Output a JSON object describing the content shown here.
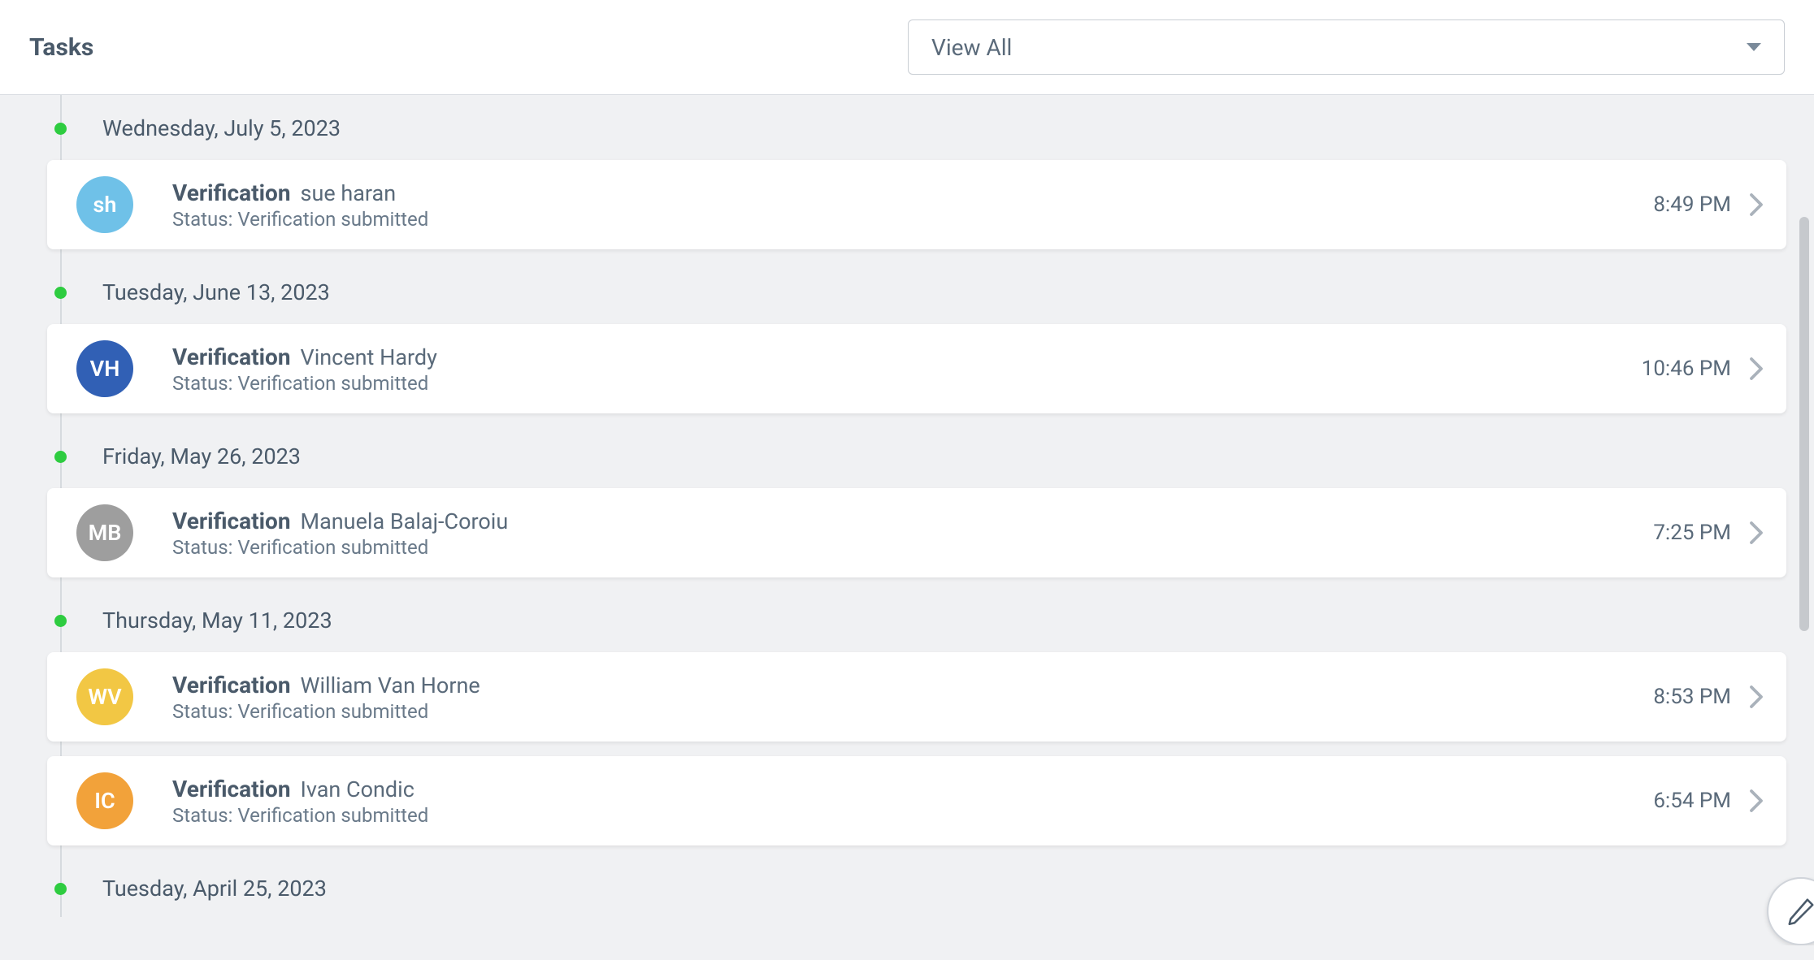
{
  "header": {
    "title": "Tasks",
    "filter_label": "View All"
  },
  "groups": [
    {
      "date": "Wednesday, July 5, 2023",
      "items": [
        {
          "type": "Verification",
          "person": "sue haran",
          "status": "Status: Verification submitted",
          "time": "8:49 PM",
          "initials": "sh",
          "avatar_color": "#6fc1e8"
        }
      ]
    },
    {
      "date": "Tuesday, June 13, 2023",
      "items": [
        {
          "type": "Verification",
          "person": "Vincent Hardy",
          "status": "Status: Verification submitted",
          "time": "10:46 PM",
          "initials": "VH",
          "avatar_color": "#3160b5"
        }
      ]
    },
    {
      "date": "Friday, May 26, 2023",
      "items": [
        {
          "type": "Verification",
          "person": "Manuela Balaj-Coroiu",
          "status": "Status: Verification submitted",
          "time": "7:25 PM",
          "initials": "MB",
          "avatar_color": "#9e9e9e"
        }
      ]
    },
    {
      "date": "Thursday, May 11, 2023",
      "items": [
        {
          "type": "Verification",
          "person": "William Van Horne",
          "status": "Status: Verification submitted",
          "time": "8:53 PM",
          "initials": "WV",
          "avatar_color": "#f2c744"
        },
        {
          "type": "Verification",
          "person": "Ivan Condic",
          "status": "Status: Verification submitted",
          "time": "6:54 PM",
          "initials": "IC",
          "avatar_color": "#f2a23a"
        }
      ]
    },
    {
      "date": "Tuesday, April 25, 2023",
      "items": []
    }
  ]
}
